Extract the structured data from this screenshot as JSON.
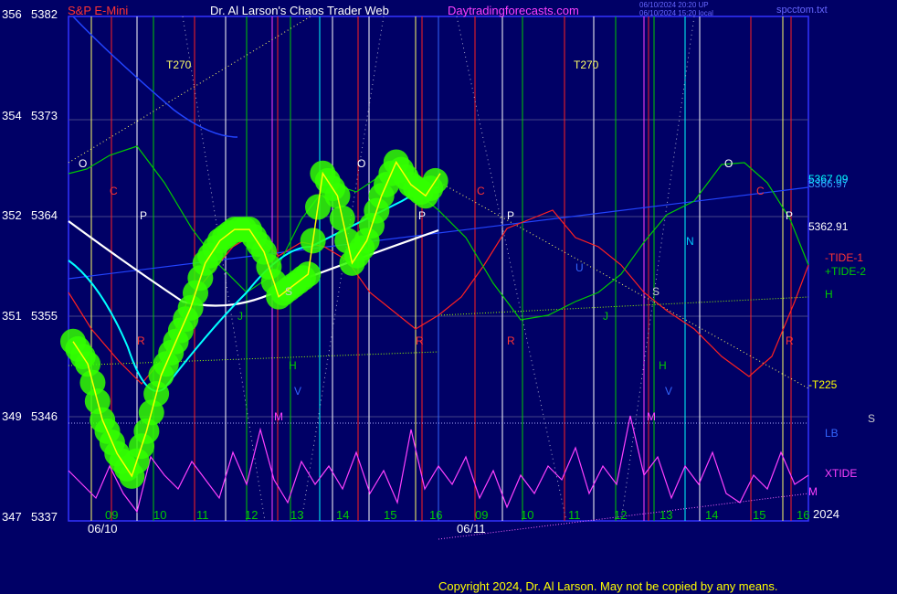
{
  "header": {
    "symbol": "S&P E-Mini",
    "title": "Dr. Al Larson's Chaos Trader Web",
    "site": "Daytradingforecasts.com",
    "stamp1": "06/10/2024 20:20 UP",
    "stamp2": "06/10/2024 15:20 local",
    "file": "spcctom.txt"
  },
  "footer": {
    "copyright": "Copyright 2024, Dr. Al Larson. May not be copied by any means."
  },
  "colors": {
    "background": "#000066",
    "price": "#ffff00",
    "ma_white": "#ffffff",
    "ma_cyan": "#00ffff",
    "tide1": "#ff2020",
    "tide2": "#00cc00",
    "xtide": "#ff40ff",
    "blob": "#33ff00"
  },
  "chart_data": {
    "type": "line",
    "title": "S&P E-Mini",
    "y_left_outer": [
      "356",
      "354",
      "352",
      "351",
      "349",
      "347"
    ],
    "y_left_inner": [
      "5382",
      "5373",
      "5364",
      "5355",
      "5346",
      "5337"
    ],
    "ylim": [
      5337,
      5382
    ],
    "x_ticks": [
      "09",
      "10",
      "11",
      "12",
      "13",
      "14",
      "15",
      "16",
      "09",
      "10",
      "11",
      "12",
      "13",
      "14",
      "15",
      "16"
    ],
    "date_labels": [
      "06/10",
      "06/11"
    ],
    "year_label": "2024",
    "right_labels": {
      "price_a": "5367.09",
      "price_b": "5366.97",
      "price_c": "5362.91",
      "tide1": "-TIDE-1",
      "tide2": "+TIDE-2",
      "h": "H",
      "t225": "-T225",
      "lb": "LB",
      "s": "S",
      "xtide": "XTIDE",
      "m": "M"
    },
    "cycle_labels": [
      "T270",
      "T270"
    ],
    "planet_markers": [
      "O",
      "C",
      "P",
      "R",
      "J",
      "S",
      "H",
      "V",
      "M",
      "N",
      "U"
    ],
    "price_series": [
      [
        0,
        5353
      ],
      [
        1,
        5351
      ],
      [
        2,
        5346
      ],
      [
        3,
        5343
      ],
      [
        4,
        5341
      ],
      [
        5,
        5345
      ],
      [
        6,
        5350
      ],
      [
        7,
        5353
      ],
      [
        8,
        5356
      ],
      [
        9,
        5360
      ],
      [
        10,
        5362
      ],
      [
        11,
        5363
      ],
      [
        12,
        5363
      ],
      [
        13,
        5361
      ],
      [
        14,
        5357
      ],
      [
        15,
        5358
      ],
      [
        16,
        5359
      ],
      [
        17,
        5368
      ],
      [
        18,
        5366
      ],
      [
        19,
        5360
      ],
      [
        20,
        5362
      ],
      [
        21,
        5366
      ],
      [
        22,
        5369
      ],
      [
        23,
        5367
      ],
      [
        24,
        5366
      ],
      [
        25,
        5368
      ]
    ]
  }
}
